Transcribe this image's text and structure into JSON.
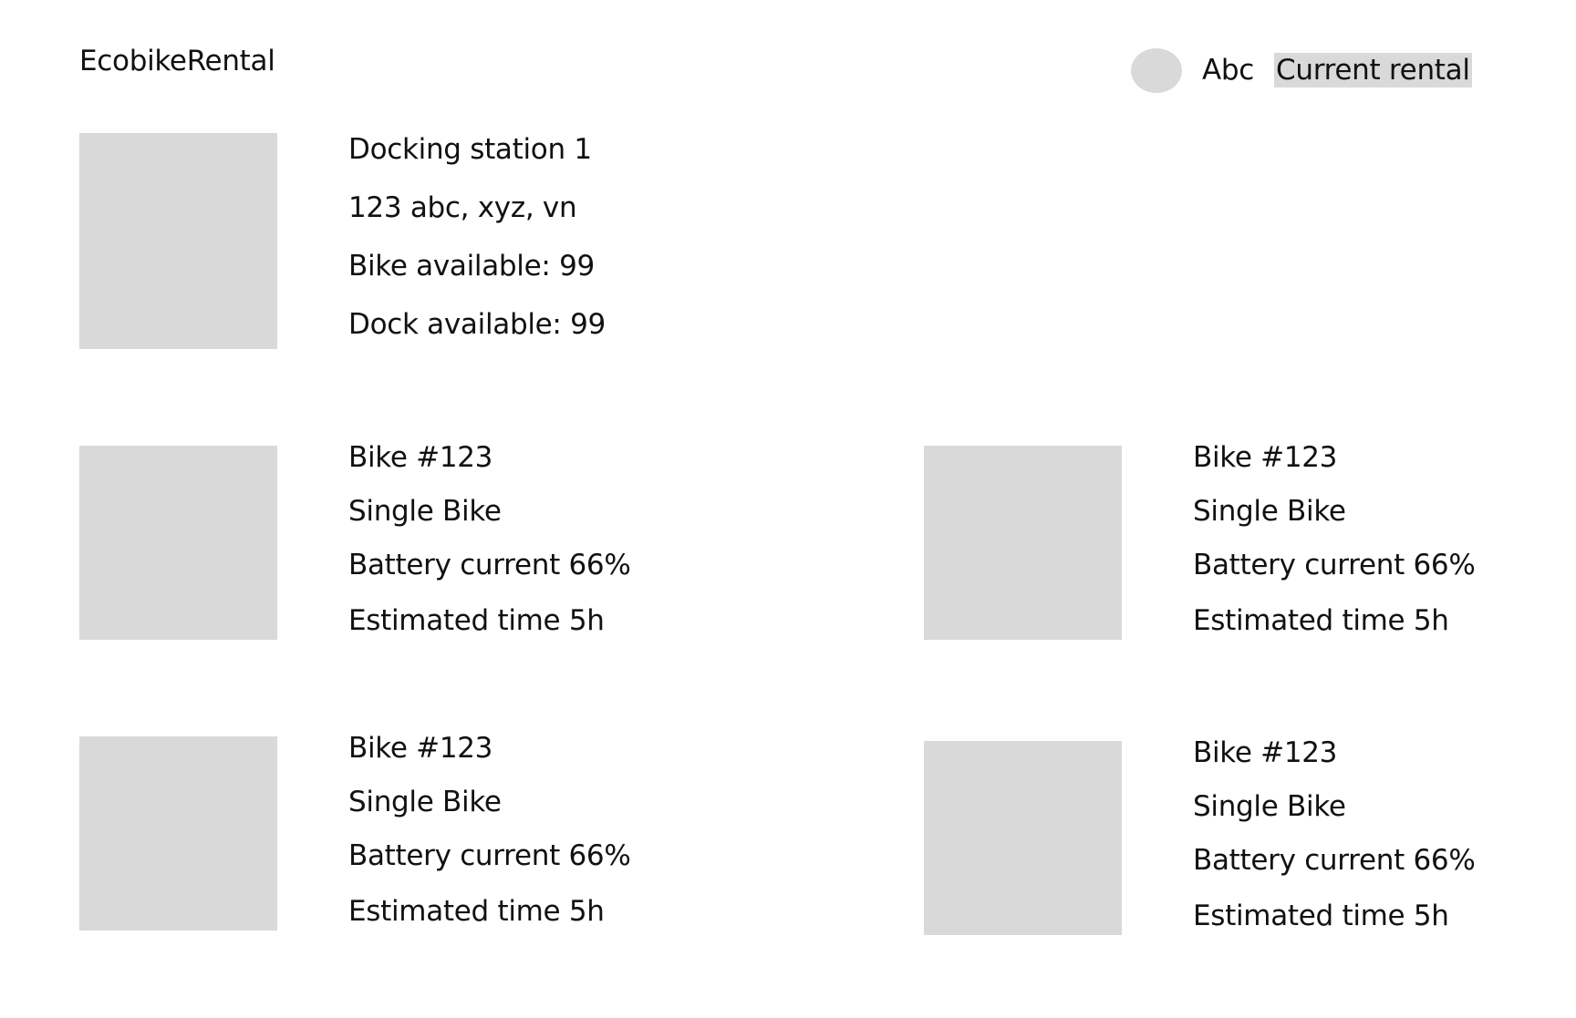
{
  "app": {
    "title": "EcobikeRental"
  },
  "header": {
    "username": "Abc",
    "current_rental_label": "Current rental"
  },
  "station": {
    "name": "Docking station 1",
    "address": "123 abc, xyz, vn",
    "bike_available": "Bike available: 99",
    "dock_available": "Dock available: 99"
  },
  "bikes": [
    {
      "id": "Bike #123",
      "type": "Single Bike",
      "battery": "Battery current 66%",
      "estimated": "Estimated time 5h"
    },
    {
      "id": "Bike #123",
      "type": "Single Bike",
      "battery": "Battery current 66%",
      "estimated": "Estimated time 5h"
    },
    {
      "id": "Bike #123",
      "type": "Single Bike",
      "battery": "Battery current 66%",
      "estimated": "Estimated time 5h"
    },
    {
      "id": "Bike #123",
      "type": "Single Bike",
      "battery": "Battery current 66%",
      "estimated": "Estimated time 5h"
    }
  ]
}
